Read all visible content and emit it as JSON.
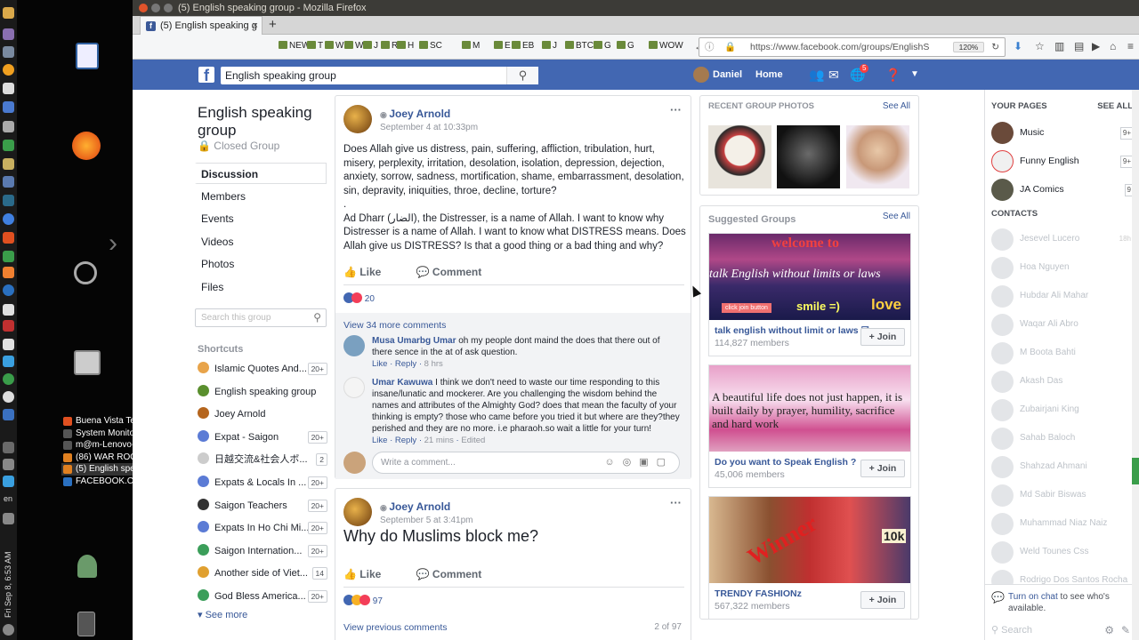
{
  "window": {
    "title": "(5) English speaking group - Mozilla Firefox"
  },
  "tab": {
    "label": "(5) English speaking g",
    "fav": "f",
    "close": "×",
    "new_tab": "+"
  },
  "bookmarks": [
    "NEW",
    "T",
    "W",
    "W",
    "J",
    "R",
    "H",
    "SC",
    "M",
    "E",
    "EB",
    "J",
    "BTC",
    "G",
    "G",
    "WOW"
  ],
  "url": {
    "value": "https://www.facebook.com/groups/EnglishS",
    "zoom": "120%"
  },
  "taskbar_list": [
    "Buena Vista Te...",
    "System Monitor",
    "m@m-Lenovo-...",
    "(86) WAR ROO...",
    "(5) English spe...",
    "FACEBOOK.COM"
  ],
  "clock": "Fri Sep 8, 6:53 AM",
  "keyboard": "en",
  "fb": {
    "logo": "f",
    "search_value": "English speaking group",
    "user": "Daniel",
    "home": "Home",
    "notif_count": "5"
  },
  "group": {
    "title": "English speaking group",
    "privacy": "Closed Group",
    "nav": [
      "Discussion",
      "Members",
      "Events",
      "Videos",
      "Photos",
      "Files"
    ],
    "search_placeholder": "Search this group",
    "shortcuts_header": "Shortcuts",
    "shortcuts": [
      {
        "label": "Islamic Quotes And...",
        "count": "20+",
        "color": "#e8a44a"
      },
      {
        "label": "English speaking group",
        "count": "",
        "color": "#5a8f2e"
      },
      {
        "label": "Joey Arnold",
        "count": "",
        "color": "#b5651d"
      },
      {
        "label": "Expat - Saigon",
        "count": "20+",
        "color": "#5b7bd5"
      },
      {
        "label": "日越交流&社会人ボ...",
        "count": "2",
        "color": "#cccccc"
      },
      {
        "label": "Expats & Locals In ...",
        "count": "20+",
        "color": "#5b7bd5"
      },
      {
        "label": "Saigon Teachers",
        "count": "20+",
        "color": "#333333"
      },
      {
        "label": "Expats In Ho Chi Mi...",
        "count": "20+",
        "color": "#5b7bd5"
      },
      {
        "label": "Saigon Internation...",
        "count": "20+",
        "color": "#3b9e5a"
      },
      {
        "label": "Another side of Viet...",
        "count": "14",
        "color": "#e0a030"
      },
      {
        "label": "God Bless America...",
        "count": "20+",
        "color": "#3b9e5a"
      }
    ],
    "see_more": "See more"
  },
  "post1": {
    "author": "Joey Arnold",
    "date": "September 4 at 10:33pm",
    "text1": "Does Allah give us distress, pain, suffering, affliction, tribulation, hurt, misery, perplexity, irritation, desolation, isolation, depression, dejection, anxiety, sorrow, sadness, mortification, shame, embarrassment, desolation, sin, depravity, iniquities, throe, decline, torture?",
    "text2": ".",
    "text3": "Ad Dharr (الضار), the Distresser, is a name of Allah. I want to know why Distresser is a name of Allah. I want to know what DISTRESS means. Does Allah give us DISTRESS? Is that a good thing or a bad thing and why?",
    "like": "Like",
    "comment": "Comment",
    "reactions": "20",
    "view_more": "View 34 more comments",
    "comments": [
      {
        "name": "Musa Umarbg Umar",
        "text": "oh my people dont maind the does that there out of there sence in the at of ask question.",
        "like": "Like",
        "reply": "Reply",
        "time": "8 hrs",
        "edited": ""
      },
      {
        "name": "Umar Kawuwa",
        "text": "I think we don't need to waste our time responding to this insane/lunatic and mockerer. Are you challenging the wisdom behind the names and attributes of the Almighty God? does that mean the faculty of your thinking is empty? those who came before you tried it but where are they?they perished and they are no more. i.e pharaoh.so wait a little for your turn!",
        "like": "Like",
        "reply": "Reply",
        "time": "21 mins",
        "edited": "Edited"
      }
    ],
    "write_placeholder": "Write a comment..."
  },
  "post2": {
    "author": "Joey Arnold",
    "date": "September 5 at 3:41pm",
    "text": "Why do Muslims block me?",
    "like": "Like",
    "comment": "Comment",
    "reactions": "97",
    "view_prev": "View previous comments",
    "pager": "2 of 97"
  },
  "right": {
    "photos_header": "RECENT GROUP PHOTOS",
    "see_all": "See All",
    "suggested_header": "Suggested Groups",
    "groups": [
      {
        "name": "talk english without limit or laws ☑",
        "members": "114,827 members",
        "join": "+ Join",
        "img_title": "welcome to",
        "img_sub": "talk English without limits or laws",
        "img_tag": "smile =)",
        "img_btn": "click join button",
        "img_love": "love"
      },
      {
        "name": "Do you want to Speak English ?",
        "members": "45,006 members",
        "join": "+ Join",
        "img_title": "A beautiful life does not just happen, it is built daily by prayer, humility, sacrifice and hard work"
      },
      {
        "name": "TRENDY FASHIONz",
        "members": "567,322 members",
        "join": "+ Join",
        "img_title": "Winner",
        "img_sub": "10k"
      }
    ]
  },
  "chat": {
    "your_pages": "YOUR PAGES",
    "see_all": "SEE ALL",
    "pages": [
      {
        "name": "Music",
        "count": "9+"
      },
      {
        "name": "Funny English",
        "count": "9+"
      },
      {
        "name": "JA Comics",
        "count": "9"
      }
    ],
    "contacts_header": "CONTACTS",
    "contacts": [
      {
        "name": "Jesevel Lucero",
        "time": "18h"
      },
      {
        "name": "Hoa Nguyen",
        "time": ""
      },
      {
        "name": "Hubdar Ali Mahar",
        "time": ""
      },
      {
        "name": "Waqar Ali Abro",
        "time": ""
      },
      {
        "name": "M Boota Bahti",
        "time": ""
      },
      {
        "name": "Akash Das",
        "time": ""
      },
      {
        "name": "Zubairjani King",
        "time": ""
      },
      {
        "name": "Sahab Baloch",
        "time": ""
      },
      {
        "name": "Shahzad Ahmani",
        "time": ""
      },
      {
        "name": "Md Sabir Biswas",
        "time": ""
      },
      {
        "name": "Muhammad Niaz Naiz",
        "time": ""
      },
      {
        "name": "Weld Tounes Css",
        "time": ""
      },
      {
        "name": "Rodrigo Dos Santos Rocha",
        "time": ""
      }
    ],
    "turn_on": "Turn on chat",
    "turn_on_rest": " to see who's available.",
    "search": "Search"
  }
}
